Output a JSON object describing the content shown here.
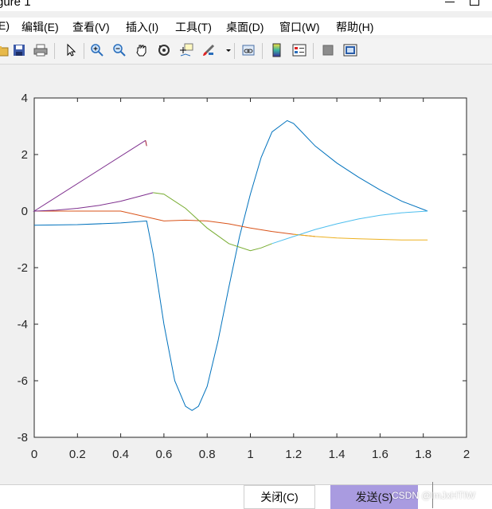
{
  "window": {
    "title": "gure 1"
  },
  "menu": [
    {
      "label": "E)"
    },
    {
      "label": "编辑(E)"
    },
    {
      "label": "查看(V)"
    },
    {
      "label": "插入(I)"
    },
    {
      "label": "工具(T)"
    },
    {
      "label": "桌面(D)"
    },
    {
      "label": "窗口(W)"
    },
    {
      "label": "帮助(H)"
    }
  ],
  "toolbar": {
    "icons": [
      "open-icon",
      "save-icon",
      "print-icon",
      "pointer-icon",
      "zoom-in-icon",
      "zoom-out-icon",
      "pan-icon",
      "rotate-icon",
      "data-cursor-icon",
      "brush-icon",
      "link-icon",
      "colorbar-icon",
      "legend-icon",
      "hide-tools-icon",
      "show-tools-icon"
    ]
  },
  "buttons": {
    "close_label": "关闭(C)",
    "send_label": "发送(S)"
  },
  "watermark": "CSDN @lmJxHTIW",
  "chart_data": {
    "type": "line",
    "title": "",
    "xlabel": "",
    "ylabel": "",
    "xlim": [
      0,
      2
    ],
    "ylim": [
      -8,
      4
    ],
    "x_ticks": [
      "0",
      "0.2",
      "0.4",
      "0.6",
      "0.8",
      "1",
      "1.2",
      "1.4",
      "1.6",
      "1.8",
      "2"
    ],
    "y_ticks": [
      "4",
      "2",
      "0",
      "-2",
      "-4",
      "-6",
      "-8"
    ],
    "grid": false,
    "series": [
      {
        "color": "#0072bd",
        "x": [
          0,
          0.2,
          0.4,
          0.52,
          0.55,
          0.6,
          0.65,
          0.7,
          0.73,
          0.76,
          0.8,
          0.85,
          0.9,
          0.95,
          1.0,
          1.05,
          1.1,
          1.17,
          1.2,
          1.3,
          1.4,
          1.5,
          1.6,
          1.7,
          1.82
        ],
        "y": [
          -0.5,
          -0.48,
          -0.42,
          -0.35,
          -1.5,
          -4.0,
          -6.0,
          -6.9,
          -7.05,
          -6.9,
          -6.2,
          -4.6,
          -2.7,
          -0.9,
          0.6,
          1.9,
          2.8,
          3.2,
          3.1,
          2.3,
          1.7,
          1.2,
          0.75,
          0.35,
          0
        ]
      },
      {
        "color": "#d95319",
        "x": [
          0,
          0.2,
          0.4,
          0.6,
          0.7,
          0.8,
          0.9,
          1.0,
          1.1,
          1.2,
          1.3
        ],
        "y": [
          0,
          0,
          0,
          -0.35,
          -0.32,
          -0.35,
          -0.45,
          -0.6,
          -0.72,
          -0.82,
          -0.9
        ]
      },
      {
        "color": "#edb120",
        "x": [
          1.2,
          1.3,
          1.4,
          1.5,
          1.6,
          1.7,
          1.82
        ],
        "y": [
          -0.82,
          -0.9,
          -0.95,
          -0.98,
          -1.0,
          -1.02,
          -1.02
        ]
      },
      {
        "color": "#7e2f8e",
        "x": [
          0,
          0.515,
          0,
          0.1,
          0.2,
          0.3,
          0.4,
          0.5,
          0.55
        ],
        "y": [
          0,
          2.5,
          0,
          0.03,
          0.1,
          0.2,
          0.35,
          0.55,
          0.65
        ]
      },
      {
        "color": "#77ac30",
        "x": [
          0.55,
          0.6,
          0.7,
          0.8,
          0.9,
          1.0,
          1.05,
          1.1
        ],
        "y": [
          0.65,
          0.6,
          0.1,
          -0.6,
          -1.15,
          -1.4,
          -1.3,
          -1.15
        ]
      },
      {
        "color": "#4dbeee",
        "x": [
          1.1,
          1.2,
          1.3,
          1.4,
          1.5,
          1.6,
          1.7,
          1.82
        ],
        "y": [
          -1.15,
          -0.9,
          -0.65,
          -0.45,
          -0.28,
          -0.15,
          -0.06,
          0
        ]
      },
      {
        "color": "#a2142f",
        "x": [
          0.515,
          0.52
        ],
        "y": [
          2.5,
          2.3
        ]
      }
    ]
  }
}
